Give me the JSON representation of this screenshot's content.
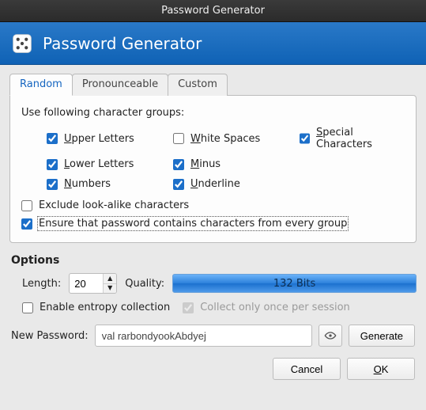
{
  "window": {
    "title": "Password Generator"
  },
  "banner": {
    "title": "Password Generator"
  },
  "tabs": {
    "random": "Random",
    "pronounceable": "Pronounceable",
    "custom": "Custom",
    "active": "random"
  },
  "groups": {
    "label": "Use following character groups:",
    "upper": {
      "label_pre": "",
      "mnemonic": "U",
      "label_post": "pper Letters",
      "checked": true
    },
    "lower": {
      "label_pre": "",
      "mnemonic": "L",
      "label_post": "ower Letters",
      "checked": true
    },
    "numbers": {
      "label_pre": "",
      "mnemonic": "N",
      "label_post": "umbers",
      "checked": true
    },
    "white": {
      "label_pre": "",
      "mnemonic": "W",
      "label_post": "hite Spaces",
      "checked": false
    },
    "minus": {
      "label_pre": "",
      "mnemonic": "M",
      "label_post": "inus",
      "checked": true
    },
    "under": {
      "label_pre": "",
      "mnemonic": "U",
      "label_post": "nderline",
      "checked": true
    },
    "special": {
      "label_pre": "",
      "mnemonic": "S",
      "label_post": "pecial Characters",
      "checked": true
    }
  },
  "exclude": {
    "label": "Exclude look-alike characters",
    "checked": false
  },
  "ensure": {
    "label": "Ensure that password contains characters from every group",
    "checked": true
  },
  "options": {
    "title": "Options",
    "length_label": "Length:",
    "length_value": "20",
    "quality_label": "Quality:",
    "quality_text": "132 Bits",
    "entropy_label": "Enable entropy collection",
    "entropy_checked": false,
    "collect_label": "Collect only once per session",
    "collect_checked": true
  },
  "password": {
    "label": "New Password:",
    "value": "val rarbondyookAbdyej"
  },
  "buttons": {
    "generate": "Generate",
    "cancel": "Cancel",
    "ok_pre": "",
    "ok_mnemonic": "O",
    "ok_post": "K"
  }
}
